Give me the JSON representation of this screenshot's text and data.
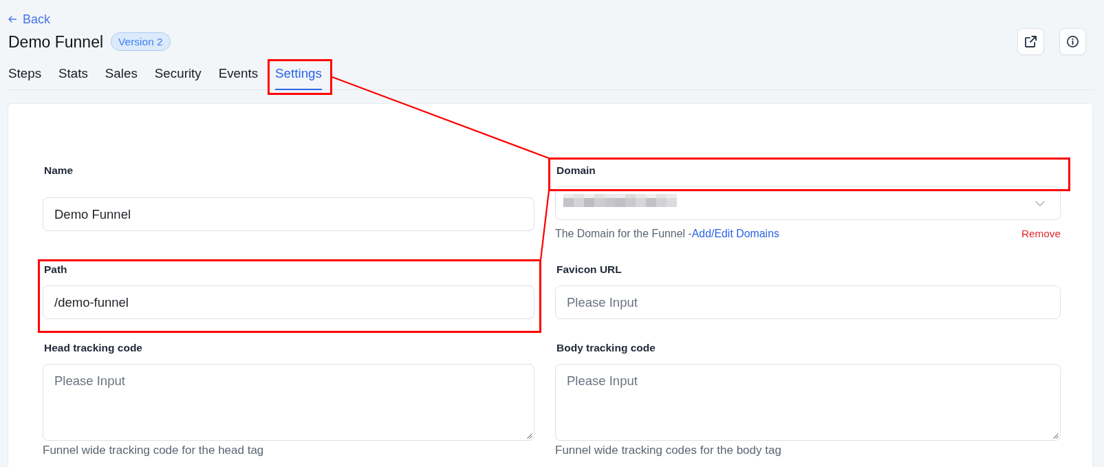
{
  "back_link": {
    "label": "Back"
  },
  "header": {
    "title": "Demo Funnel",
    "badge": "Version 2"
  },
  "tabs": [
    {
      "label": "Steps",
      "selected": false,
      "highlighted": false
    },
    {
      "label": "Stats",
      "selected": false,
      "highlighted": false
    },
    {
      "label": "Sales",
      "selected": false,
      "highlighted": false
    },
    {
      "label": "Security",
      "selected": false,
      "highlighted": false
    },
    {
      "label": "Events",
      "selected": false,
      "highlighted": false
    },
    {
      "label": "Settings",
      "selected": true,
      "highlighted": true
    }
  ],
  "fields": [
    {
      "kind": "text",
      "label": "Name",
      "value": "Demo Funnel",
      "highlighted": false
    },
    {
      "kind": "select",
      "label": "Domain",
      "value_redacted": true,
      "help": "The Domain for the Funnel -",
      "help_link": "Add/Edit Domains",
      "action": "Remove",
      "highlighted": true
    },
    {
      "kind": "text",
      "label": "Path",
      "value": "/demo-funnel",
      "highlighted": true
    },
    {
      "kind": "text",
      "label": "Favicon URL",
      "placeholder": "Please Input",
      "highlighted": false
    },
    {
      "kind": "textarea",
      "label": "Head tracking code",
      "placeholder": "Please Input",
      "help": "Funnel wide tracking code for the head tag",
      "highlighted": false
    },
    {
      "kind": "textarea",
      "label": "Body tracking code",
      "placeholder": "Please Input",
      "help": "Funnel wide tracking codes for the body tag",
      "highlighted": false
    }
  ],
  "highlight_connectors": true
}
